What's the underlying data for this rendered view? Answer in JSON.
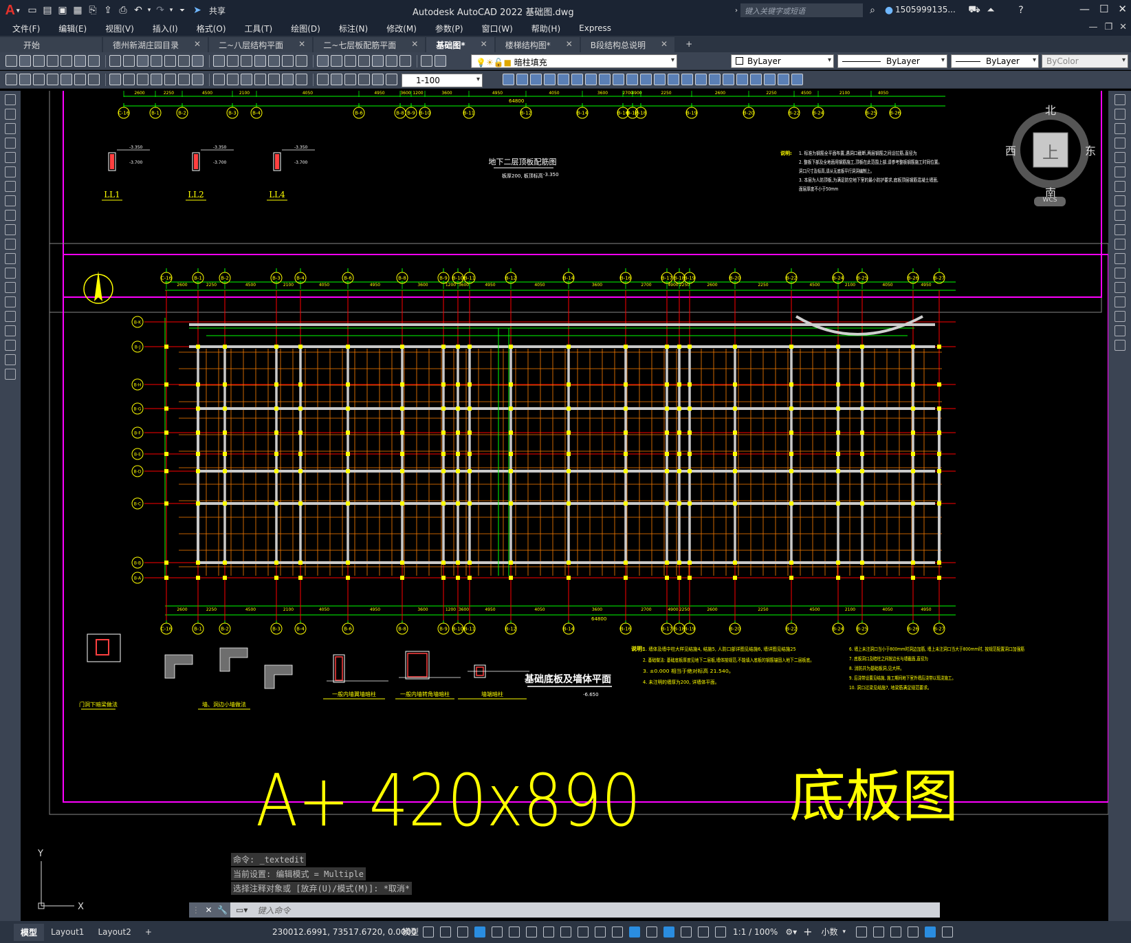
{
  "titlebar": {
    "logo": "A",
    "share": "共享",
    "title": "Autodesk AutoCAD 2022    基础图.dwg",
    "search_placeholder": "键入关键字或短语",
    "user": "1505999135...",
    "win_min": "—",
    "win_max": "☐",
    "win_close": "✕"
  },
  "menu": [
    "文件(F)",
    "编辑(E)",
    "视图(V)",
    "插入(I)",
    "格式(O)",
    "工具(T)",
    "绘图(D)",
    "标注(N)",
    "修改(M)",
    "参数(P)",
    "窗口(W)",
    "帮助(H)",
    "Express"
  ],
  "tabs": [
    {
      "label": "开始",
      "active": false,
      "close": false
    },
    {
      "label": "德州新湖庄园目录",
      "active": false,
      "close": true
    },
    {
      "label": "二~八层结构平面",
      "active": false,
      "close": true
    },
    {
      "label": "二~七层板配筋平面",
      "active": false,
      "close": true
    },
    {
      "label": "基础图*",
      "active": true,
      "close": true
    },
    {
      "label": "楼梯结构图*",
      "active": false,
      "close": true
    },
    {
      "label": "B段结构总说明",
      "active": false,
      "close": true
    }
  ],
  "toolbar1": {
    "layer": "暗柱填充",
    "color": "ByLayer",
    "linetype": "ByLayer",
    "lineweight": "ByLayer",
    "plotstyle": "ByColor"
  },
  "toolbar2": {
    "scale": "1-100"
  },
  "viewcube": {
    "north": "北",
    "south": "南",
    "east": "东",
    "west": "西",
    "top": "上",
    "wcs": "WCS"
  },
  "drawing": {
    "upper_plan_title": "地下二层顶板配筋图",
    "upper_plan_note": "板厚200, 板顶标高",
    "upper_plan_elev": "-3.350",
    "beam_labels": [
      "LL1",
      "LL2",
      "LL4"
    ],
    "beam_elevs": [
      "-3.350",
      "-3.700"
    ],
    "main_plan_title": "基础底板及墙体平面",
    "main_plan_elev": "-6.650",
    "total_dim": "64800",
    "top_dims": [
      "2600",
      "2250",
      "4500",
      "2100",
      "4050",
      "4950",
      "3600",
      "1200",
      "3600",
      "4950",
      "4050",
      "3600",
      "2700",
      "4900",
      "2250"
    ],
    "grid_labels": [
      "C-16",
      "B-1",
      "B-2",
      "B-3",
      "B-4",
      "B-6",
      "B-8",
      "B-9",
      "B-10",
      "B-11",
      "B-12",
      "B-14",
      "B-16",
      "B-17",
      "B-18",
      "B-19",
      "B-20",
      "B-22",
      "B-24",
      "B-25",
      "B-26",
      "B-27"
    ],
    "row_labels": [
      "B-K",
      "B-J",
      "B-H",
      "B-G",
      "B-F",
      "B-E",
      "B-D",
      "B-C",
      "B-B",
      "B-A"
    ],
    "detail_titles": [
      "门洞下暗梁做法",
      "墙、洞边小墙做法",
      "一般内墙翼墙暗柱",
      "一般内墙转角墙暗柱",
      "墙端暗柱"
    ],
    "notes_label": "说明:",
    "notes_upper": [
      "1. 标准为钢筋全平面布置,遇洞口截断,两层钢筋之间设拉筋,直径为",
      "2. 整板下部及全地面用钢筋施工,顶板在此范围上部,请参考整板钢筋施工时同位置。",
      "洞口尺寸及标高,请从无底板平行洞洞编制上。",
      "3. 本层为人防顶板,为满足防空地下室的最小防护要求,底板顶层钢筋混凝土墙面,",
      "面层厚度不小于50mm"
    ],
    "notes_lower": [
      "1. 墙体及墙中柱大样见结施4, 结施5, 人防口部详图见结施6, 墙详图见结施25",
      "2. 基础做法: 基础底板厚度见地下二层板,墙体按规范,不能填入底板的钢筋锚固入地下二层板底。",
      "3. ±0.000 相当于绝对标高 21.540。",
      "4. 未注明的墙厚为200, 详墙体平面。",
      "6. 墙上未注洞口当小于800mm时洞边加筋, 墙上未注洞口当大于800mm时, 按规范配置洞口加强筋",
      "7. 底板洞口及暗柱之间按边长与墙截面,直径为",
      "8. 消防井为基础板洞,见大样。",
      "9. 后浇带设置见结施, 施工期间地下室外墙后浇带以现浇施工。",
      "10. 洞口过梁见结施7, 地梁筋满足规范要求。"
    ],
    "big_title_left": "A+ 420x890",
    "big_title_right": "底板图"
  },
  "command": {
    "history": [
      "命令: _textedit",
      "当前设置: 编辑模式 = Multiple",
      "选择注释对象或 [放弃(U)/模式(M)]: *取消*"
    ],
    "placeholder": "键入命令"
  },
  "status": {
    "layouts": [
      "模型",
      "Layout1",
      "Layout2"
    ],
    "add_layout": "+",
    "coords": "230012.6991, 73517.6720, 0.0000",
    "space": "模型",
    "annoscale": "1:1 / 100%",
    "units": "小数"
  },
  "colors": {
    "title_bg": "#1b2433",
    "toolbar_bg": "#3b4453",
    "border_magenta": "#ff00ff",
    "drawing_yellow": "#ffff00",
    "drawing_red": "#ff0000",
    "drawing_orange": "#ff8000",
    "drawing_green": "#00ff00",
    "drawing_cyan": "#00ffff"
  }
}
